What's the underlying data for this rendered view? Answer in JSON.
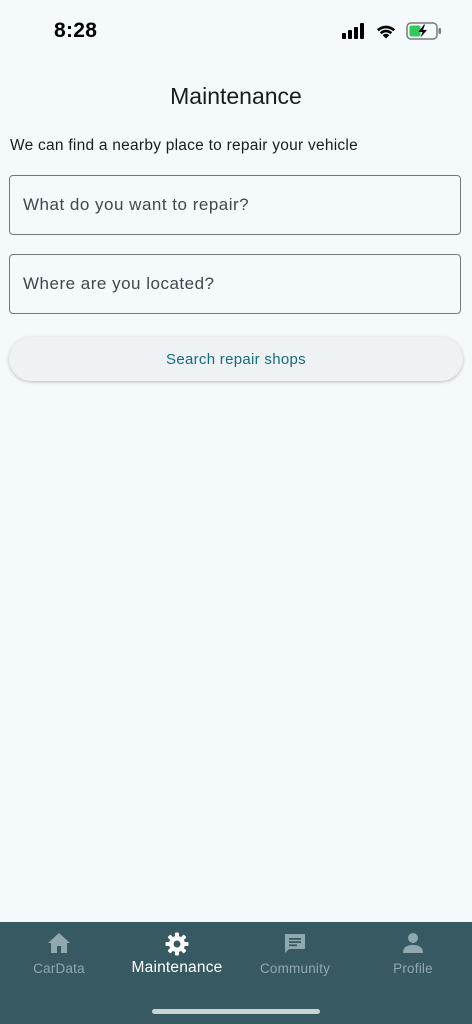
{
  "status_bar": {
    "time": "8:28",
    "icons": [
      "cellular-signal-icon",
      "wifi-icon",
      "battery-charging-icon"
    ]
  },
  "page": {
    "title": "Maintenance",
    "subtitle": "We can find a nearby place to repair your vehicle"
  },
  "form": {
    "repair_placeholder": "What do you want to repair?",
    "location_placeholder": "Where are you located?",
    "search_button_label": "Search repair shops"
  },
  "bottom_nav": {
    "items": [
      {
        "label": "CarData",
        "icon": "home-icon",
        "active": false
      },
      {
        "label": "Maintenance",
        "icon": "gear-icon",
        "active": true
      },
      {
        "label": "Community",
        "icon": "chat-icon",
        "active": false
      },
      {
        "label": "Profile",
        "icon": "person-icon",
        "active": false
      }
    ]
  },
  "colors": {
    "background": "#f4f9fc",
    "nav_background": "#375a62",
    "accent": "#156b7b",
    "battery_green": "#34c759"
  }
}
